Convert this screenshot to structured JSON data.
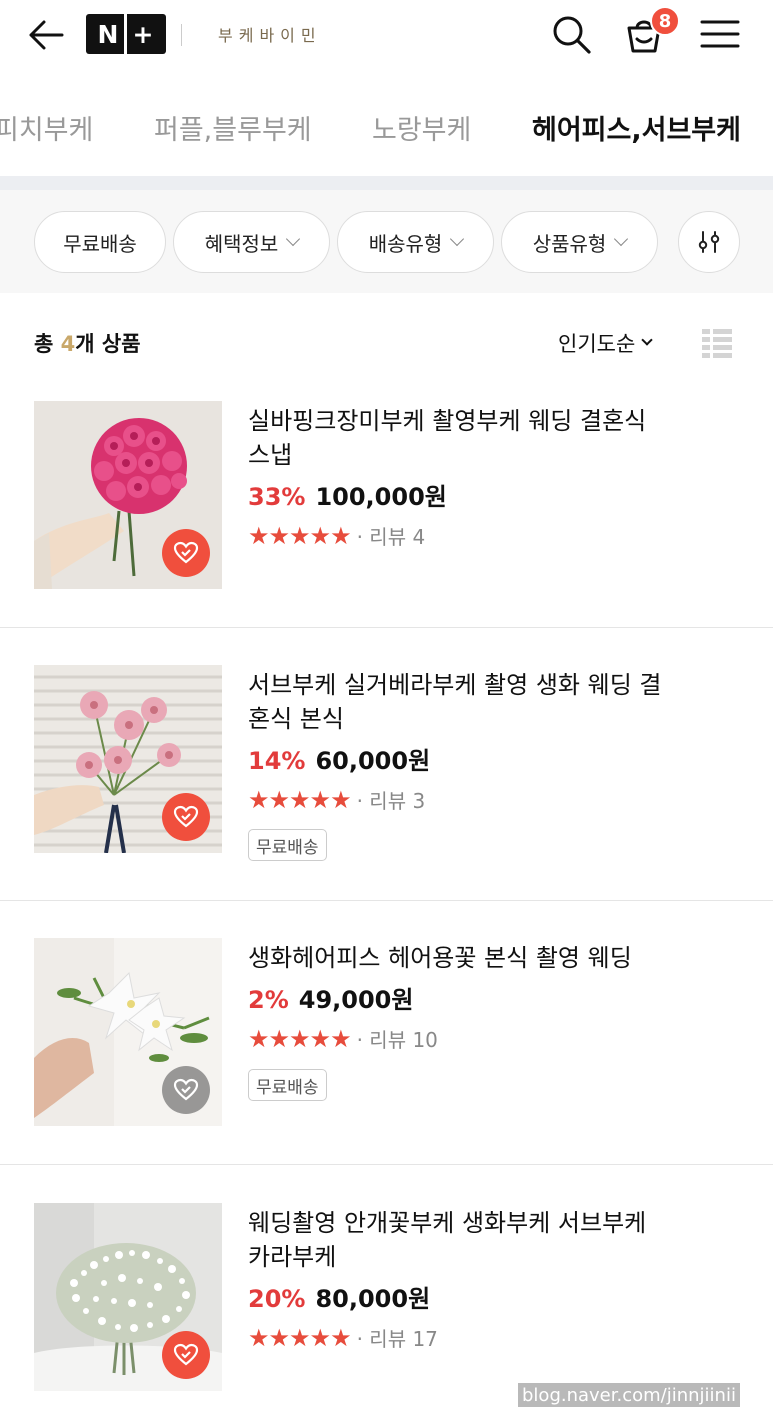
{
  "header": {
    "logo_left": "N",
    "logo_right": "+",
    "store_name": "부케바이민",
    "cart_count": "8"
  },
  "tabs": [
    {
      "label": "피치부케",
      "active": false
    },
    {
      "label": "퍼플,블루부케",
      "active": false
    },
    {
      "label": "노랑부케",
      "active": false
    },
    {
      "label": "헤어피스,서브부케",
      "active": true
    }
  ],
  "filters": {
    "free_shipping": "무료배송",
    "benefit": "혜택정보",
    "delivery_type": "배송유형",
    "product_type": "상품유형"
  },
  "list_header": {
    "count_prefix": "총 ",
    "count_value": "4",
    "count_suffix": "개 상품",
    "sort_label": "인기도순"
  },
  "products": [
    {
      "title": "실바핑크장미부케 촬영부케 웨딩 결혼식 스냅",
      "discount": "33%",
      "price": "100,000원",
      "stars": "★★★★★",
      "review": "· 리뷰 4",
      "tag": "",
      "wished": true
    },
    {
      "title": "서브부케 실거베라부케 촬영 생화 웨딩 결혼식 본식",
      "discount": "14%",
      "price": "60,000원",
      "stars": "★★★★★",
      "review": "· 리뷰 3",
      "tag": "무료배송",
      "wished": true
    },
    {
      "title": "생화헤어피스 헤어용꽃 본식 촬영 웨딩",
      "discount": "2%",
      "price": "49,000원",
      "stars": "★★★★★",
      "review": "· 리뷰 10",
      "tag": "무료배송",
      "wished": false
    },
    {
      "title": "웨딩촬영 안개꽃부케 생화부케 서브부케 카라부케",
      "discount": "20%",
      "price": "80,000원",
      "stars": "★★★★★",
      "review": "· 리뷰 17",
      "tag": "",
      "wished": true
    }
  ],
  "watermark": "blog.naver.com/jinnjiinii",
  "colors": {
    "accent_red": "#e23b3b",
    "wish_red": "#f04f3d",
    "count_gold": "#c9a86a"
  },
  "icons": [
    "back-arrow-icon",
    "search-icon",
    "cart-icon",
    "hamburger-menu-icon",
    "filter-sliders-icon",
    "list-view-icon",
    "wish-heart-icon"
  ]
}
